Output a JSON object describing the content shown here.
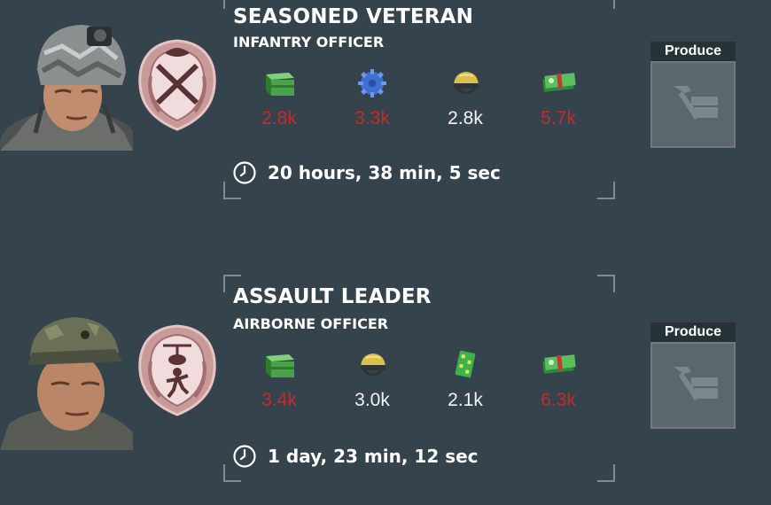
{
  "cards": [
    {
      "title": "SEASONED VETERAN",
      "subtitle": "INFANTRY OFFICER",
      "resources": [
        {
          "icon": "supplies-crate-icon",
          "value": "2.8k",
          "short": true
        },
        {
          "icon": "gear-parts-icon",
          "value": "3.3k",
          "short": true
        },
        {
          "icon": "helmet-icon",
          "value": "2.8k",
          "short": false
        },
        {
          "icon": "cash-icon",
          "value": "5.7k",
          "short": true
        }
      ],
      "time": "20 hours, 38 min, 5 sec",
      "produce_label": "Produce"
    },
    {
      "title": "ASSAULT LEADER",
      "subtitle": "AIRBORNE OFFICER",
      "resources": [
        {
          "icon": "supplies-crate-icon",
          "value": "3.4k",
          "short": true
        },
        {
          "icon": "helmet-icon",
          "value": "3.0k",
          "short": false
        },
        {
          "icon": "circuit-board-icon",
          "value": "2.1k",
          "short": false
        },
        {
          "icon": "cash-icon",
          "value": "6.3k",
          "short": true
        }
      ],
      "time": "1 day, 23 min, 12 sec",
      "produce_label": "Produce"
    }
  ],
  "colors": {
    "background": "#34434c",
    "shortage": "#c42b2b",
    "produce_label_bg": "#263238"
  }
}
